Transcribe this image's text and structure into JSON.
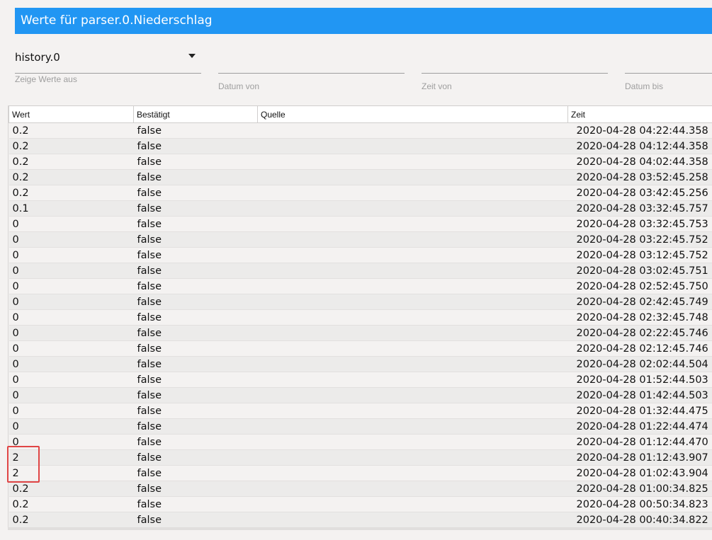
{
  "dialog": {
    "title": "Werte für parser.0.Niederschlag"
  },
  "filters": {
    "instance_value": "history.0",
    "instance_helper": "Zeige Werte aus",
    "date_from_label": "Datum von",
    "time_from_label": "Zeit von",
    "date_to_label": "Datum bis"
  },
  "table": {
    "columns": [
      "Wert",
      "Bestätigt",
      "Quelle",
      "Zeit"
    ],
    "rows": [
      {
        "wert": "0.2",
        "bestaetigt": "false",
        "quelle": "",
        "zeit": "2020-04-28 04:22:44.358"
      },
      {
        "wert": "0.2",
        "bestaetigt": "false",
        "quelle": "",
        "zeit": "2020-04-28 04:12:44.358"
      },
      {
        "wert": "0.2",
        "bestaetigt": "false",
        "quelle": "",
        "zeit": "2020-04-28 04:02:44.358"
      },
      {
        "wert": "0.2",
        "bestaetigt": "false",
        "quelle": "",
        "zeit": "2020-04-28 03:52:45.258"
      },
      {
        "wert": "0.2",
        "bestaetigt": "false",
        "quelle": "",
        "zeit": "2020-04-28 03:42:45.256"
      },
      {
        "wert": "0.1",
        "bestaetigt": "false",
        "quelle": "",
        "zeit": "2020-04-28 03:32:45.757"
      },
      {
        "wert": "0",
        "bestaetigt": "false",
        "quelle": "",
        "zeit": "2020-04-28 03:32:45.753"
      },
      {
        "wert": "0",
        "bestaetigt": "false",
        "quelle": "",
        "zeit": "2020-04-28 03:22:45.752"
      },
      {
        "wert": "0",
        "bestaetigt": "false",
        "quelle": "",
        "zeit": "2020-04-28 03:12:45.752"
      },
      {
        "wert": "0",
        "bestaetigt": "false",
        "quelle": "",
        "zeit": "2020-04-28 03:02:45.751"
      },
      {
        "wert": "0",
        "bestaetigt": "false",
        "quelle": "",
        "zeit": "2020-04-28 02:52:45.750"
      },
      {
        "wert": "0",
        "bestaetigt": "false",
        "quelle": "",
        "zeit": "2020-04-28 02:42:45.749"
      },
      {
        "wert": "0",
        "bestaetigt": "false",
        "quelle": "",
        "zeit": "2020-04-28 02:32:45.748"
      },
      {
        "wert": "0",
        "bestaetigt": "false",
        "quelle": "",
        "zeit": "2020-04-28 02:22:45.746"
      },
      {
        "wert": "0",
        "bestaetigt": "false",
        "quelle": "",
        "zeit": "2020-04-28 02:12:45.746"
      },
      {
        "wert": "0",
        "bestaetigt": "false",
        "quelle": "",
        "zeit": "2020-04-28 02:02:44.504"
      },
      {
        "wert": "0",
        "bestaetigt": "false",
        "quelle": "",
        "zeit": "2020-04-28 01:52:44.503"
      },
      {
        "wert": "0",
        "bestaetigt": "false",
        "quelle": "",
        "zeit": "2020-04-28 01:42:44.503"
      },
      {
        "wert": "0",
        "bestaetigt": "false",
        "quelle": "",
        "zeit": "2020-04-28 01:32:44.475"
      },
      {
        "wert": "0",
        "bestaetigt": "false",
        "quelle": "",
        "zeit": "2020-04-28 01:22:44.474"
      },
      {
        "wert": "0",
        "bestaetigt": "false",
        "quelle": "",
        "zeit": "2020-04-28 01:12:44.470"
      },
      {
        "wert": "2",
        "bestaetigt": "false",
        "quelle": "",
        "zeit": "2020-04-28 01:12:43.907"
      },
      {
        "wert": "2",
        "bestaetigt": "false",
        "quelle": "",
        "zeit": "2020-04-28 01:02:43.904"
      },
      {
        "wert": "0.2",
        "bestaetigt": "false",
        "quelle": "",
        "zeit": "2020-04-28 01:00:34.825"
      },
      {
        "wert": "0.2",
        "bestaetigt": "false",
        "quelle": "",
        "zeit": "2020-04-28 00:50:34.823"
      },
      {
        "wert": "0.2",
        "bestaetigt": "false",
        "quelle": "",
        "zeit": "2020-04-28 00:40:34.822"
      }
    ]
  },
  "colors": {
    "title_bar": "#2196f3",
    "highlight_box": "#e04545"
  }
}
